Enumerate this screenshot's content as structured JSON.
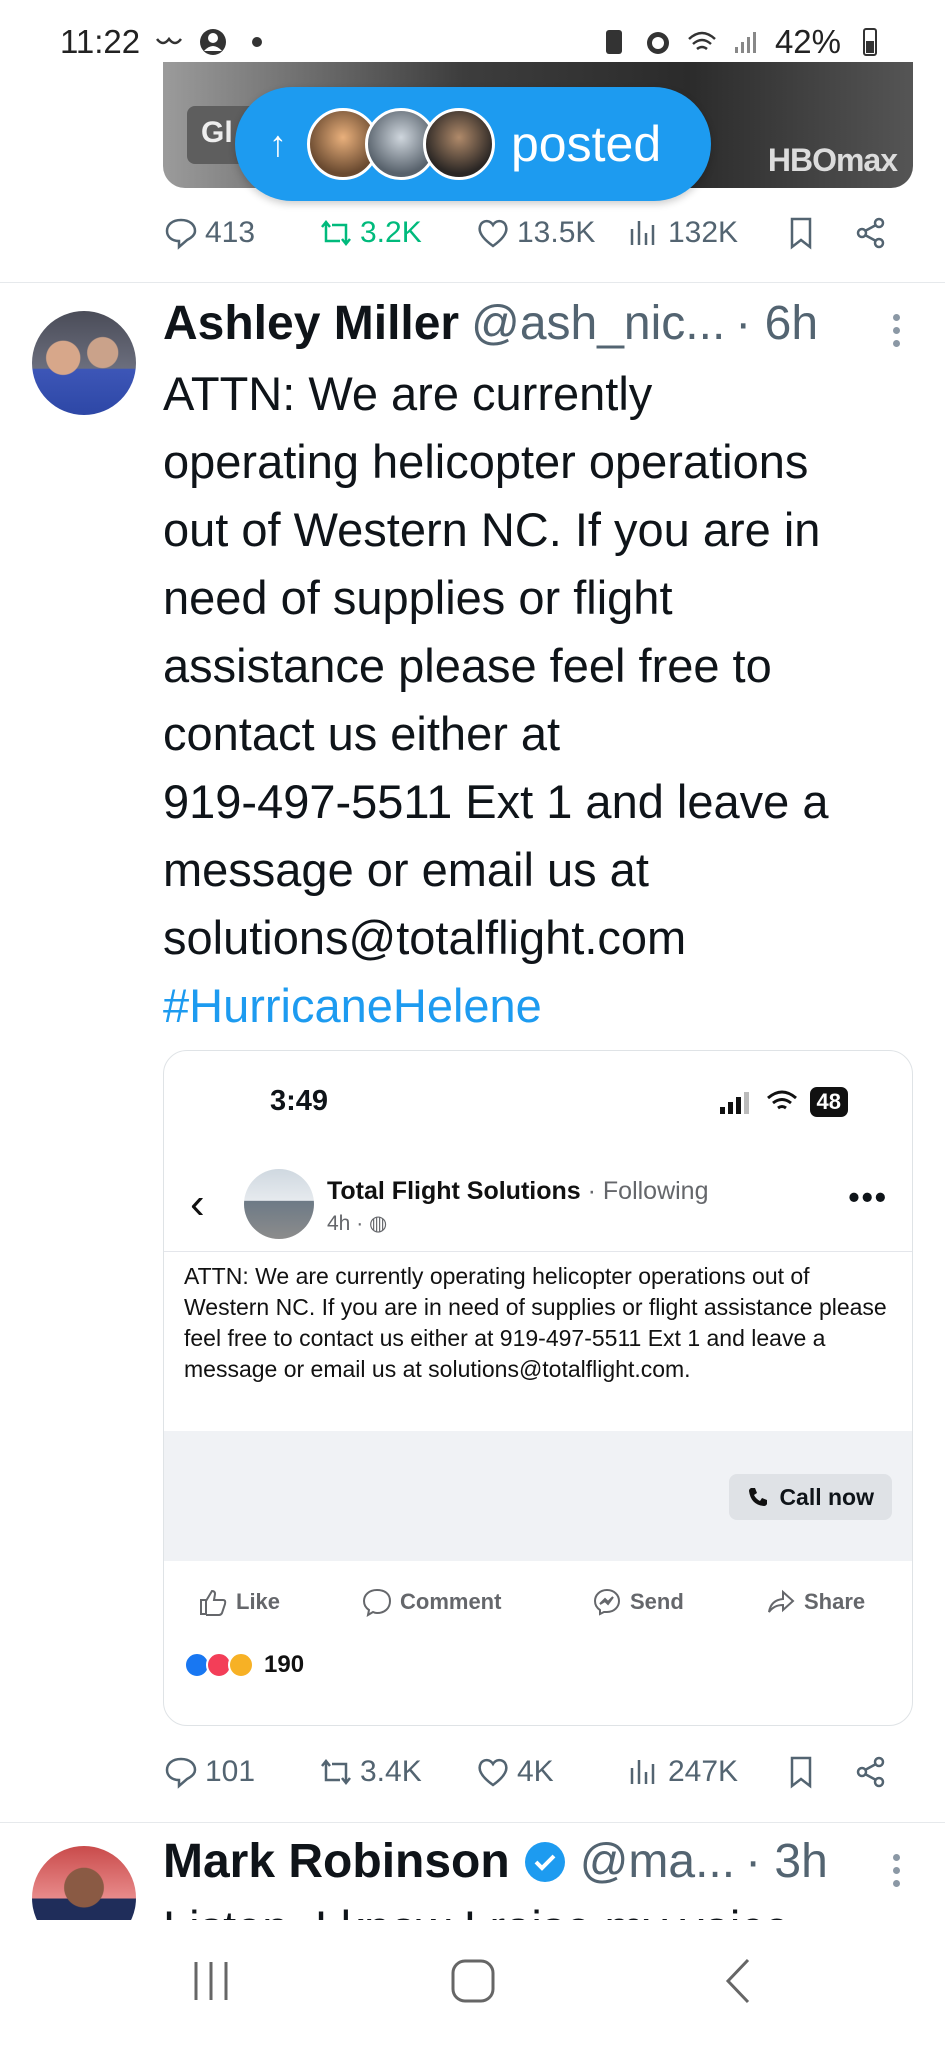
{
  "status_bar": {
    "time": "11:22",
    "battery": "42%"
  },
  "top_post": {
    "posted_label": "posted",
    "media_tag": "Gl",
    "media_logo": "HBOmax",
    "stats": {
      "replies": "413",
      "reposts": "3.2K",
      "likes": "13.5K",
      "views": "132K"
    }
  },
  "tweet1": {
    "name": "Ashley Miller",
    "handle": "@ash_nic...",
    "time": "· 6h",
    "text": "ATTN: We are currently\noperating helicopter operations\nout of Western NC.  If you are in\nneed of supplies or flight\nassistance please feel free to\ncontact us either at\n919-497-5511 Ext 1 and leave a\nmessage or email us at\nsolutions@totalflight.com",
    "hashtag": "#HurricaneHelene",
    "embed": {
      "status_time": "3:49",
      "status_battery": "48",
      "page_name": "Total Flight Solutions",
      "following": " · Following",
      "meta": "4h ·",
      "body": "ATTN: We are currently operating helicopter operations out of Western NC.  If you are in need of supplies or flight assistance please feel free to contact us either at 919-497-5511 Ext 1 and leave a message or email us at solutions@totalflight.com.",
      "call_now": "Call now",
      "actions": {
        "like": "Like",
        "comment": "Comment",
        "send": "Send",
        "share": "Share"
      },
      "reaction_count": "190"
    },
    "stats": {
      "replies": "101",
      "reposts": "3.4K",
      "likes": "4K",
      "views": "247K"
    }
  },
  "tweet2": {
    "name": "Mark Robinson",
    "handle": "@ma...",
    "time": "· 3h",
    "partial_text": "Listen, I know I raise my voice"
  },
  "colors": {
    "accent": "#1d9bf0",
    "repost_green": "#00ba7c",
    "secondary_text": "#536471"
  }
}
